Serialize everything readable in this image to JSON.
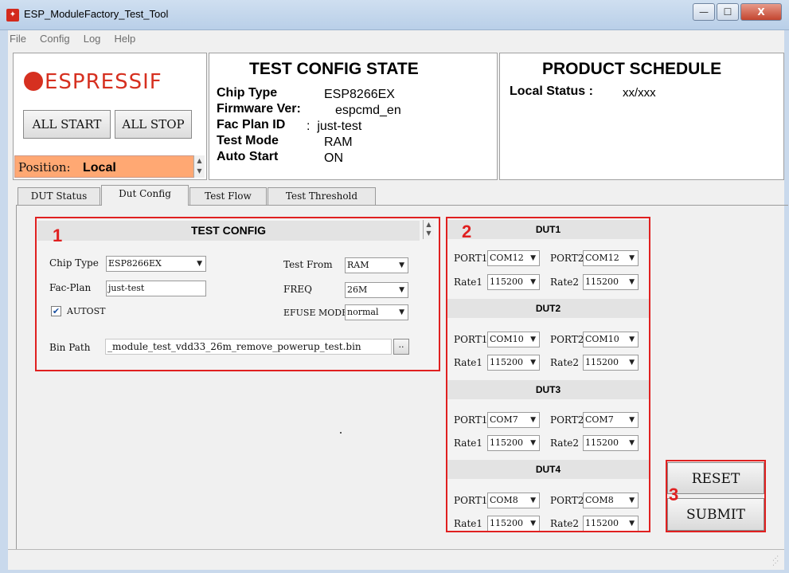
{
  "window": {
    "title": "ESP_ModuleFactory_Test_Tool",
    "minimize": "—",
    "maximize": "☐",
    "close": "X"
  },
  "menu": [
    "File",
    "Config",
    "Log",
    "Help"
  ],
  "logo": {
    "text": "ESPRESSIF"
  },
  "controls": {
    "all_start": "ALL START",
    "all_stop": "ALL STOP",
    "position_label": "Position:",
    "position_value": "Local"
  },
  "test_config_state": {
    "title": "TEST CONFIG STATE",
    "rows": [
      {
        "key": "Chip Type",
        "value": "ESP8266EX"
      },
      {
        "key": "Firmware Ver:",
        "value": "espcmd_en"
      },
      {
        "key": "Fac Plan ID",
        "value": ":  just-test"
      },
      {
        "key": "Test Mode",
        "value": "RAM"
      },
      {
        "key": "Auto Start",
        "value": "ON"
      }
    ]
  },
  "product_schedule": {
    "title": "PRODUCT SCHEDULE",
    "status_label": "Local Status :",
    "status_value": "xx/xxx"
  },
  "tabs": [
    "DUT Status",
    "Dut Config",
    "Test Flow",
    "Test Threshold"
  ],
  "test_config": {
    "number": "1",
    "title": "TEST CONFIG",
    "chip_type_label": "Chip Type",
    "chip_type_value": "ESP8266EX",
    "fac_plan_label": "Fac-Plan",
    "fac_plan_value": "just-test",
    "autost_label": "AUTOST",
    "test_from_label": "Test From",
    "test_from_value": "RAM",
    "freq_label": "FREQ",
    "freq_value": "26M",
    "efuse_label": "EFUSE MODE",
    "efuse_value": "normal",
    "bin_path_label": "Bin Path",
    "bin_path_value": "_module_test_vdd33_26m_remove_powerup_test.bin",
    "browse": ".."
  },
  "dut_panel": {
    "number": "2",
    "duts": [
      {
        "title": "DUT1",
        "port1_label": "PORT1",
        "port1": "COM12",
        "port2_label": "PORT2",
        "port2": "COM12",
        "rate1_label": "Rate1",
        "rate1": "115200",
        "rate2_label": "Rate2",
        "rate2": "115200"
      },
      {
        "title": "DUT2",
        "port1_label": "PORT1",
        "port1": "COM10",
        "port2_label": "PORT2",
        "port2": "COM10",
        "rate1_label": "Rate1",
        "rate1": "115200",
        "rate2_label": "Rate2",
        "rate2": "115200"
      },
      {
        "title": "DUT3",
        "port1_label": "PORT1",
        "port1": "COM7",
        "port2_label": "PORT2",
        "port2": "COM7",
        "rate1_label": "Rate1",
        "rate1": "115200",
        "rate2_label": "Rate2",
        "rate2": "115200"
      },
      {
        "title": "DUT4",
        "port1_label": "PORT1",
        "port1": "COM8",
        "port2_label": "PORT2",
        "port2": "COM8",
        "rate1_label": "Rate1",
        "rate1": "115200",
        "rate2_label": "Rate2",
        "rate2": "115200"
      }
    ]
  },
  "actions": {
    "number": "3",
    "reset": "RESET",
    "submit": "SUBMIT"
  },
  "colors": {
    "accent_red": "#e02020",
    "position_bg": "#ffa873",
    "brand": "#d63020"
  }
}
